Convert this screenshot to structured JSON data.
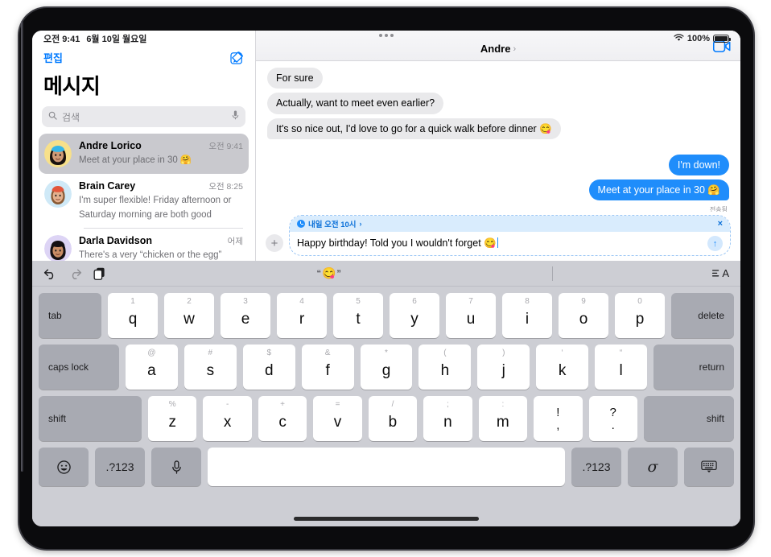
{
  "status_bar": {
    "time": "오전 9:41",
    "date": "6월 10일 월요일",
    "wifi_icon": "wifi-icon",
    "battery_percent": "100%"
  },
  "sidebar": {
    "edit_label": "편집",
    "compose_icon": "compose-icon",
    "title": "메시지",
    "search": {
      "placeholder": "검색",
      "search_icon": "search-icon",
      "mic_icon": "microphone-icon"
    },
    "conversations": [
      {
        "name": "Andre Lorico",
        "time": "오전 9:41",
        "preview": "Meet at your place in 30 🤗",
        "selected": true,
        "avatar_bg": "#f7e08a"
      },
      {
        "name": "Brain Carey",
        "time": "오전 8:25",
        "preview": "I'm super flexible! Friday afternoon or Saturday morning are both good",
        "selected": false,
        "avatar_bg": "#cfe9f7"
      },
      {
        "name": "Darla Davidson",
        "time": "어제",
        "preview": "There's a very “chicken or the egg” thing happening here",
        "selected": false,
        "avatar_bg": "#ddd4f5"
      }
    ]
  },
  "chat": {
    "title": "Andre",
    "title_chevron": "›",
    "facetime_icon": "video-camera-icon",
    "messages": [
      {
        "text": "For sure",
        "side": "in"
      },
      {
        "text": "Actually, want to meet even earlier?",
        "side": "in"
      },
      {
        "text": "It's so nice out, I'd love to go for a quick walk before dinner 😋",
        "side": "in"
      },
      {
        "text": "I'm down!",
        "side": "out"
      },
      {
        "text": "Meet at your place in 30 🤗",
        "side": "out"
      }
    ],
    "delivery_status": "전송됨"
  },
  "composer": {
    "plus_icon": "plus-icon",
    "schedule_label": "내일 오전 10시",
    "schedule_chevron": "›",
    "schedule_clock_icon": "clock-icon",
    "close_icon": "×",
    "text": "Happy birthday! Told you I wouldn't forget 😋",
    "send_icon": "↑"
  },
  "keyboard": {
    "toolbar": {
      "undo_icon": "undo-arrow-icon",
      "redo_icon": "redo-arrow-icon",
      "paste_icon": "paste-documents-icon",
      "suggestion": "😋",
      "quote_open": "“",
      "quote_close": "”",
      "format_icon": "text-format-icon",
      "format_label": "A"
    },
    "rows": [
      {
        "keys": [
          {
            "label": "tab",
            "type": "mod",
            "class": "tab left"
          },
          {
            "hint": "1",
            "label": "q"
          },
          {
            "hint": "2",
            "label": "w"
          },
          {
            "hint": "3",
            "label": "e"
          },
          {
            "hint": "4",
            "label": "r"
          },
          {
            "hint": "5",
            "label": "t"
          },
          {
            "hint": "6",
            "label": "y"
          },
          {
            "hint": "7",
            "label": "u"
          },
          {
            "hint": "8",
            "label": "i"
          },
          {
            "hint": "9",
            "label": "o"
          },
          {
            "hint": "0",
            "label": "p"
          },
          {
            "label": "delete",
            "type": "mod",
            "class": "delete right"
          }
        ]
      },
      {
        "keys": [
          {
            "label": "caps lock",
            "type": "mod",
            "class": "caps left"
          },
          {
            "hint": "@",
            "label": "a"
          },
          {
            "hint": "#",
            "label": "s"
          },
          {
            "hint": "$",
            "label": "d"
          },
          {
            "hint": "&",
            "label": "f"
          },
          {
            "hint": "*",
            "label": "g"
          },
          {
            "hint": "(",
            "label": "h"
          },
          {
            "hint": ")",
            "label": "j"
          },
          {
            "hint": "‘",
            "label": "k"
          },
          {
            "hint": "“",
            "label": "l"
          },
          {
            "label": "return",
            "type": "mod",
            "class": "return right"
          }
        ]
      },
      {
        "keys": [
          {
            "label": "shift",
            "type": "mod",
            "class": "shift-l left"
          },
          {
            "hint": "%",
            "label": "z"
          },
          {
            "hint": "-",
            "label": "x"
          },
          {
            "hint": "+",
            "label": "c"
          },
          {
            "hint": "=",
            "label": "v"
          },
          {
            "hint": "/",
            "label": "b"
          },
          {
            "hint": ";",
            "label": "n"
          },
          {
            "hint": ":",
            "label": "m"
          },
          {
            "upper": "!",
            "lower": ",",
            "dual": true
          },
          {
            "upper": "?",
            "lower": ".",
            "dual": true
          },
          {
            "label": "shift",
            "type": "mod",
            "class": "shift-r right"
          }
        ]
      },
      {
        "keys": [
          {
            "label": "😀",
            "type": "mod",
            "class": "bottom",
            "icon": "emoji-icon"
          },
          {
            "label": ".?123",
            "type": "mod",
            "class": "bottom num"
          },
          {
            "label": "🎤",
            "type": "mod",
            "class": "bottom",
            "icon": "microphone-icon"
          },
          {
            "label": "",
            "type": "space",
            "class": "space"
          },
          {
            "label": ".?123",
            "type": "mod",
            "class": "bottom num"
          },
          {
            "label": "𝜎",
            "type": "mod",
            "class": "bottom",
            "icon": "handwriting-icon"
          },
          {
            "label": "⌨",
            "type": "mod",
            "class": "bottom",
            "icon": "dismiss-keyboard-icon"
          }
        ]
      }
    ]
  },
  "colors": {
    "accent_blue": "#007aff",
    "bubble_out": "#1f8dfb",
    "bubble_in": "#e9e9eb",
    "keyboard_bg": "#cdced4"
  }
}
